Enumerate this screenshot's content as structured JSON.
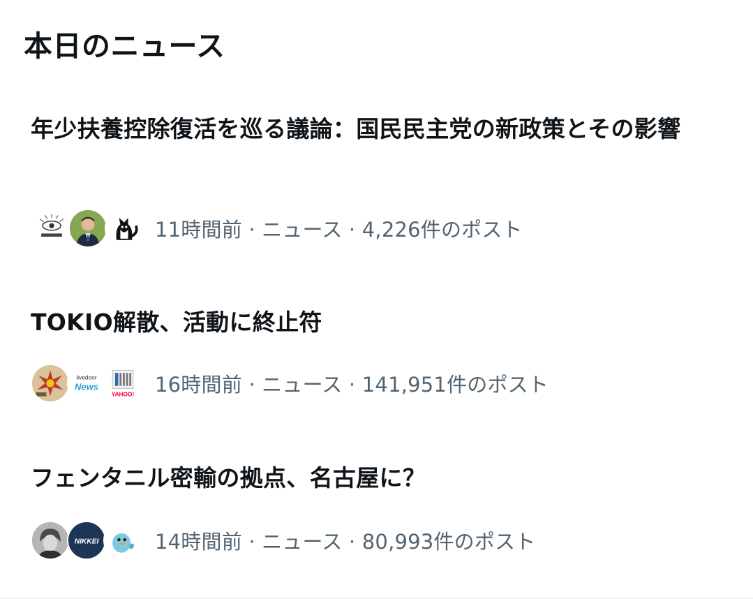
{
  "section": {
    "title": "本日のニュース"
  },
  "news": [
    {
      "headline": "年少扶養控除復活を巡る議論：国民民主党の新政策とその影響",
      "meta": "11時間前 · ニュース · 4,226件のポスト",
      "avatars": [
        "eye-logo-avatar",
        "man-portrait-avatar",
        "cat-avatar"
      ]
    },
    {
      "headline": "TOKIO解散、活動に終止符",
      "meta": "16時間前 · ニュース · 141,951件のポスト",
      "avatars": [
        "explosion-avatar",
        "livedoor-news-avatar",
        "yahoo-news-avatar"
      ],
      "avatar_labels": {
        "livedoor_top": "livedoor",
        "livedoor_bottom": "News",
        "yahoo": "YAHOO!"
      }
    },
    {
      "headline": "フェンタニル密輸の拠点、名古屋に？",
      "meta": "14時間前 · ニュース · 80,993件のポスト",
      "avatars": [
        "person-photo-avatar",
        "nikkei-avatar",
        "blue-bird-avatar"
      ],
      "avatar_labels": {
        "nikkei": "NIKKEI"
      }
    }
  ],
  "colors": {
    "text_primary": "#0f1419",
    "text_secondary": "#536471",
    "nikkei_navy": "#1d3557",
    "divider": "#eff3f4"
  }
}
